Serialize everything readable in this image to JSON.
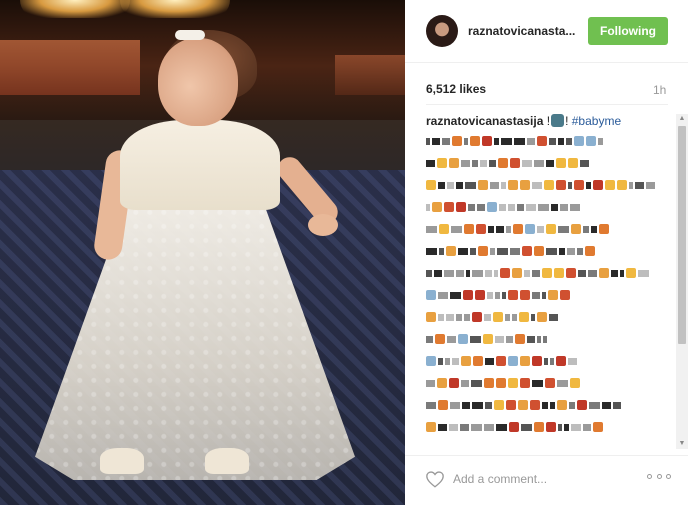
{
  "post": {
    "username": "raznatovicanasta...",
    "follow_label": "Following",
    "likes": "6,512 likes",
    "time_ago": "1h",
    "caption": {
      "author": "raznatovicanastasija",
      "text_before": " !",
      "text_after": "! ",
      "hashtag": "#babyme"
    },
    "comment_placeholder": "Add a comment..."
  },
  "colors": {
    "follow_green": "#70c050",
    "hashtag_blue": "#2a5b9a"
  },
  "icons": [
    "heart-icon",
    "more-options-icon",
    "scroll-up-icon",
    "scroll-down-icon"
  ],
  "obscured_comment_lines": 17
}
